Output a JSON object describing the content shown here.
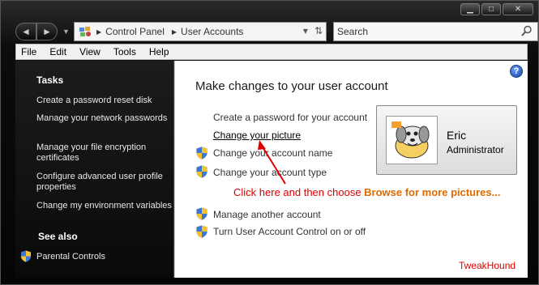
{
  "window": {
    "caption_buttons": [
      "minimize",
      "maximize",
      "close"
    ]
  },
  "navigation": {
    "back_icon": "arrow-left-icon",
    "forward_icon": "arrow-right-icon"
  },
  "address_bar": {
    "crumbs": [
      "Control Panel",
      "User Accounts"
    ]
  },
  "search": {
    "placeholder": "Search"
  },
  "menu": [
    "File",
    "Edit",
    "View",
    "Tools",
    "Help"
  ],
  "sidebar": {
    "tasks_heading": "Tasks",
    "tasks": [
      "Create a password reset disk",
      "Manage your network passwords",
      "Manage your file encryption certificates",
      "Configure advanced user profile properties",
      "Change my environment variables"
    ],
    "see_also_heading": "See also",
    "see_also": [
      "Parental Controls"
    ]
  },
  "main": {
    "title": "Make changes to your user account",
    "tasks": [
      "Create a password for your account",
      "Change your picture",
      "Change your account name",
      "Change your account type"
    ],
    "tasks2": [
      "Manage another account",
      "Turn User Account Control on or off"
    ],
    "user": {
      "name": "Eric",
      "role": "Administrator"
    },
    "annotation": {
      "prefix": "Click here and then choose ",
      "highlight": "Browse for more pictures..."
    },
    "watermark": "TweakHound",
    "colors": {
      "annotation": "#e00000",
      "highlight": "#e06a00"
    }
  }
}
